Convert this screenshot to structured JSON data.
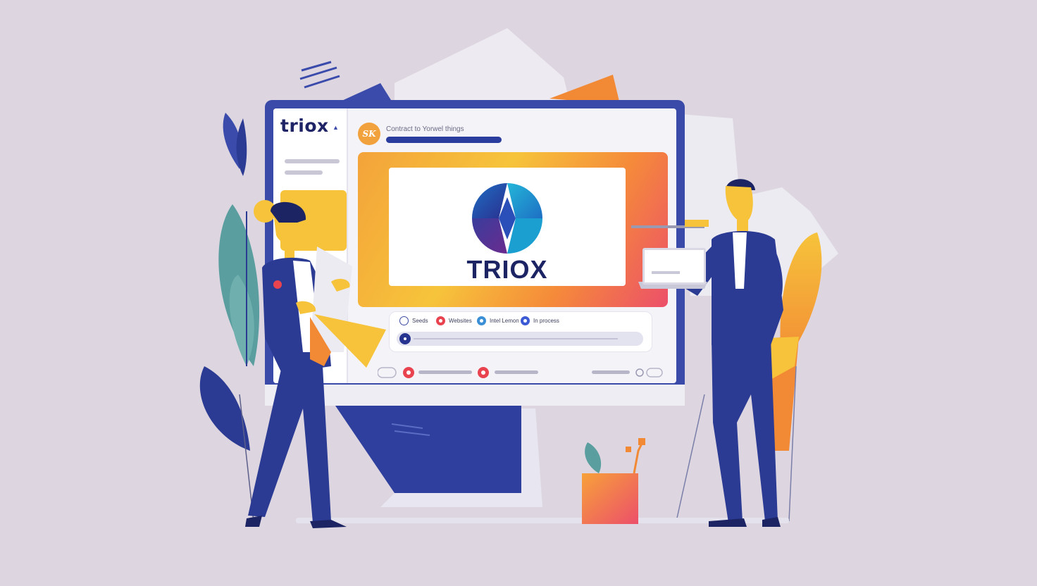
{
  "sidebar": {
    "logo": "triox"
  },
  "header": {
    "avatar_text": "SK",
    "text": "Contract to Yorwel things"
  },
  "hero": {
    "brand": "TRIOX"
  },
  "chips": [
    {
      "label": "Seeds",
      "color": "#ffffff",
      "border": "#3b4aa0"
    },
    {
      "label": "Websites",
      "color": "#e8434f"
    },
    {
      "label": "Intel Lemon",
      "color": "#3b8fd4"
    },
    {
      "label": "In process",
      "color": "#3c5ad4"
    }
  ],
  "colors": {
    "navy": "#2b3b93",
    "dark_navy": "#1c2463",
    "orange": "#f28a35",
    "yellow": "#f6c33b",
    "pink": "#ec4f6a",
    "teal": "#5a9ea0",
    "background": "#ddd6e0"
  }
}
